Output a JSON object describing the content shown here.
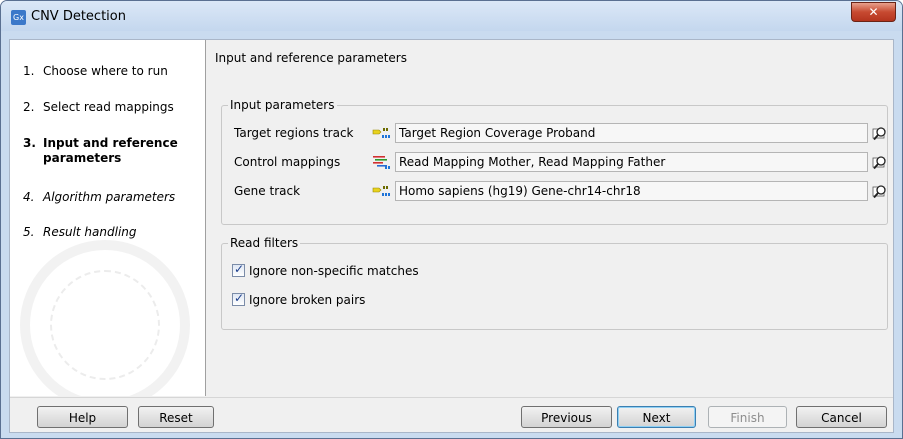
{
  "window": {
    "title": "CNV Detection",
    "app_icon_text": "Gx",
    "close_symbol": "✕"
  },
  "steps": [
    {
      "num": "1.",
      "label": "Choose where to run",
      "state": "done"
    },
    {
      "num": "2.",
      "label": "Select read mappings",
      "state": "done"
    },
    {
      "num": "3.",
      "label": "Input and reference",
      "label2": "parameters",
      "state": "current"
    },
    {
      "num": "4.",
      "label": "Algorithm parameters",
      "state": "future"
    },
    {
      "num": "5.",
      "label": "Result handling",
      "state": "future"
    }
  ],
  "main": {
    "title": "Input and reference parameters",
    "input_group": {
      "legend": "Input parameters",
      "rows": [
        {
          "label": "Target regions track",
          "value": "Target Region Coverage Proband",
          "icon": "annotation-track-icon"
        },
        {
          "label": "Control mappings",
          "value": "Read Mapping Mother, Read Mapping Father",
          "icon": "read-mapping-icon"
        },
        {
          "label": "Gene track",
          "value": "Homo sapiens (hg19) Gene-chr14-chr18",
          "icon": "annotation-track-icon"
        }
      ]
    },
    "filter_group": {
      "legend": "Read filters",
      "options": [
        {
          "label": "Ignore non-specific matches",
          "checked": true
        },
        {
          "label": "Ignore broken pairs",
          "checked": true
        }
      ]
    }
  },
  "buttons": {
    "help": "Help",
    "reset": "Reset",
    "previous": "Previous",
    "next": "Next",
    "finish": "Finish",
    "cancel": "Cancel"
  },
  "colors": {
    "titlebar": "#c4d7ee",
    "close_button": "#c74a31",
    "default_button_border": "#3c7fb1"
  }
}
